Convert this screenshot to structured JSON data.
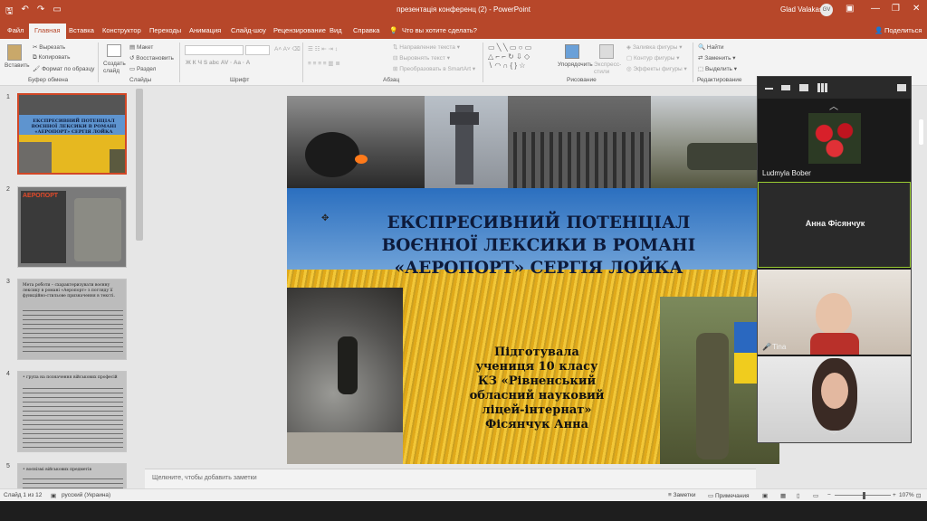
{
  "titlebar": {
    "doc_title": "презентація конференц (2) - PowerPoint",
    "user_name": "Glad Valakas",
    "user_initials": "GV"
  },
  "tabs": [
    "Файл",
    "Главная",
    "Вставка",
    "Конструктор",
    "Переходы",
    "Анимация",
    "Слайд-шоу",
    "Рецензирование",
    "Вид",
    "Справка"
  ],
  "tell_me": "Что вы хотите сделать?",
  "share": "Поделиться",
  "ribbon": {
    "clipboard": {
      "paste": "Вставить",
      "cut": "Вырезать",
      "copy": "Копировать",
      "format": "Формат по образцу",
      "label": "Буфер обмена"
    },
    "slides": {
      "new_slide": "Создать слайд",
      "layout": "Макет",
      "reset": "Восстановить",
      "section": "Раздел",
      "label": "Слайды"
    },
    "font": {
      "label": "Шрифт"
    },
    "paragraph": {
      "text_dir": "Направление текста",
      "align_text": "Выровнять текст",
      "smartart": "Преобразовать в SmartArt",
      "label": "Абзац"
    },
    "drawing": {
      "arrange": "Упорядочить",
      "quick_styles": "Экспресс-стили",
      "fill": "Заливка фигуры",
      "outline": "Контур фигуры",
      "effects": "Эффекты фигуры",
      "label": "Рисование"
    },
    "editing": {
      "find": "Найти",
      "replace": "Заменить",
      "select": "Выделить",
      "label": "Редактирование"
    }
  },
  "thumbnails": {
    "numbers": [
      "1",
      "2",
      "3",
      "4",
      "5"
    ],
    "t1_lines": [
      "ЕКСПРЕСИВНИЙ ПОТЕНЦІАЛ",
      "ВОЄННОЇ ЛЕКСИКИ В РОМАНІ",
      "«АЕРОПОРТ» СЕРГІЯ ЛОЙКА"
    ],
    "t2_title": "АЕРОПОРТ",
    "t3_text": "Мета роботи – схарактеризувати воєнну лексику в романі «Аеропорт» з погляду її функційно-стильове призначення в тексті.",
    "t4_text": "• група на позначення військових професій",
    "t5_text": "• воєнізмі військових предметів"
  },
  "slide": {
    "title_lines": [
      "ЕКСПРЕСИВНИЙ ПОТЕНЦІАЛ",
      "ВОЄННОЇ ЛЕКСИКИ В РОМАНІ",
      "«АЕРОПОРТ» СЕРГІЯ ЛОЙКА"
    ],
    "author_lines": [
      "Підготувала",
      "учениця 10 класу",
      "КЗ «Рівненський",
      "обласний науковий",
      "ліцей-інтернат»",
      "Фісянчук Анна"
    ]
  },
  "notes_placeholder": "Щелкните, чтобы добавить заметки",
  "status": {
    "slide_of": "Слайд 1 из 12",
    "language": "русский (Украина)",
    "notes": "Заметки",
    "comments": "Примечания",
    "zoom": "107%"
  },
  "zoom_panel": {
    "participants": [
      {
        "name": "Ludmyla Bober"
      },
      {
        "name": "Анна Фісянчук"
      },
      {
        "name": "Tina"
      },
      {
        "name": ""
      }
    ]
  },
  "colors": {
    "accent": "#b7472a",
    "selected_thumb": "#d24726",
    "speaker_border": "#9acd32"
  }
}
